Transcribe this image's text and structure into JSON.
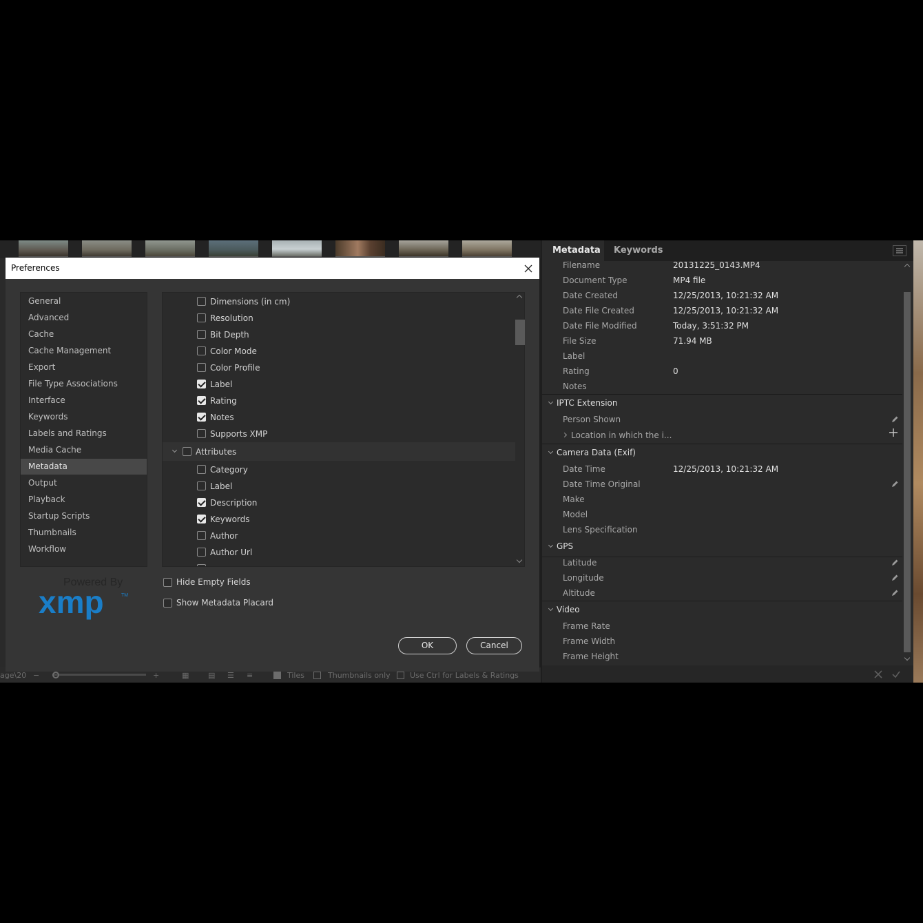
{
  "dialog": {
    "title": "Preferences",
    "nav_items": [
      "General",
      "Advanced",
      "Cache",
      "Cache Management",
      "Export",
      "File Type Associations",
      "Interface",
      "Keywords",
      "Labels and Ratings",
      "Media Cache",
      "Metadata",
      "Output",
      "Playback",
      "Startup Scripts",
      "Thumbnails",
      "Workflow"
    ],
    "active_nav": "Metadata",
    "logo": {
      "powered_by": "Powered By",
      "brand": "xmp",
      "tm": "TM"
    },
    "metadata_fields": [
      {
        "label": "Dimensions (in cm)",
        "checked": false
      },
      {
        "label": "Resolution",
        "checked": false
      },
      {
        "label": "Bit Depth",
        "checked": false
      },
      {
        "label": "Color Mode",
        "checked": false
      },
      {
        "label": "Color Profile",
        "checked": false
      },
      {
        "label": "Label",
        "checked": true
      },
      {
        "label": "Rating",
        "checked": true
      },
      {
        "label": "Notes",
        "checked": true
      },
      {
        "label": "Supports XMP",
        "checked": false
      }
    ],
    "attributes_group": {
      "label": "Attributes",
      "checked": false
    },
    "attribute_fields": [
      {
        "label": "Category",
        "checked": false
      },
      {
        "label": "Label",
        "checked": false
      },
      {
        "label": "Description",
        "checked": true
      },
      {
        "label": "Keywords",
        "checked": true
      },
      {
        "label": "Author",
        "checked": false
      },
      {
        "label": "Author Url",
        "checked": false
      }
    ],
    "options": {
      "hide_empty_fields": "Hide Empty Fields",
      "show_metadata_placard": "Show Metadata Placard"
    },
    "buttons": {
      "ok": "OK",
      "cancel": "Cancel"
    }
  },
  "statusbar": {
    "path_fragment": "age\\20",
    "tiles": "Tiles",
    "thumbnails_only": "Thumbnails only",
    "use_ctrl": "Use Ctrl for Labels & Ratings"
  },
  "meta_panel": {
    "tabs": [
      "Metadata",
      "Keywords"
    ],
    "file_properties": [
      {
        "label": "Filename",
        "value": "20131225_0143.MP4"
      },
      {
        "label": "Document Type",
        "value": "MP4 file"
      },
      {
        "label": "Date Created",
        "value": "12/25/2013, 10:21:32 AM"
      },
      {
        "label": "Date File Created",
        "value": "12/25/2013, 10:21:32 AM"
      },
      {
        "label": "Date File Modified",
        "value": "Today, 3:51:32 PM"
      },
      {
        "label": "File Size",
        "value": "71.94 MB"
      },
      {
        "label": "Label",
        "value": ""
      },
      {
        "label": "Rating",
        "value": "0"
      },
      {
        "label": "Notes",
        "value": ""
      }
    ],
    "iptc_ext": {
      "title": "IPTC Extension",
      "person_shown": "Person Shown",
      "location": "Location in which the i..."
    },
    "camera": {
      "title": "Camera Data (Exif)",
      "fields": [
        {
          "label": "Date Time",
          "value": "12/25/2013, 10:21:32 AM"
        },
        {
          "label": "Date Time Original",
          "value": ""
        },
        {
          "label": "Make",
          "value": ""
        },
        {
          "label": "Model",
          "value": ""
        },
        {
          "label": "Lens Specification",
          "value": ""
        }
      ]
    },
    "gps": {
      "title": "GPS",
      "fields": [
        "Latitude",
        "Longitude",
        "Altitude"
      ]
    },
    "video": {
      "title": "Video",
      "fields": [
        "Frame Rate",
        "Frame Width",
        "Frame Height"
      ]
    }
  }
}
